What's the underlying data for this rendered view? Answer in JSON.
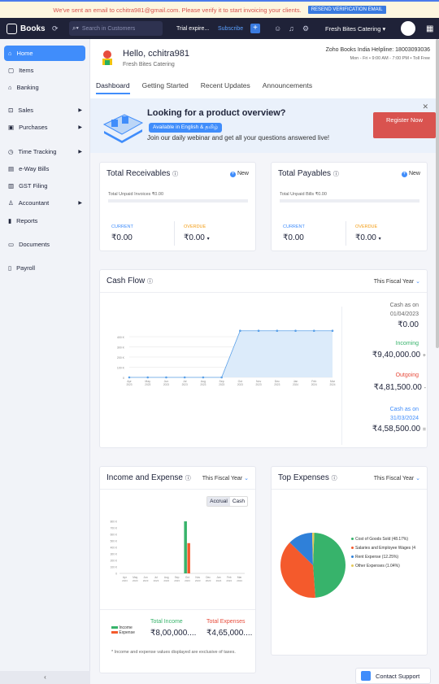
{
  "banner": {
    "message": "We've sent an email to cchitra981@gmail.com. Please verify it to start invoicing your clients.",
    "button": "RESEND VERIFICATION EMAIL"
  },
  "topbar": {
    "app_name": "Books",
    "search_placeholder": "Search in Customers",
    "trial": "Trial expire...",
    "subscribe": "Subscribe",
    "org": "Fresh Bites Catering"
  },
  "sidebar": {
    "items": [
      {
        "label": "Home"
      },
      {
        "label": "Items"
      },
      {
        "label": "Banking"
      },
      {
        "label": "Sales"
      },
      {
        "label": "Purchases"
      },
      {
        "label": "Time Tracking"
      },
      {
        "label": "e-Way Bills"
      },
      {
        "label": "GST Filing"
      },
      {
        "label": "Accountant"
      },
      {
        "label": "Reports"
      },
      {
        "label": "Documents"
      },
      {
        "label": "Payroll"
      }
    ]
  },
  "header": {
    "hello": "Hello, cchitra981",
    "company": "Fresh Bites Catering",
    "helpline": "Zoho Books India Helpline: 18003093036",
    "hours": "Mon - Fri • 9:00 AM - 7:00 PM • Toll Free"
  },
  "tabs": [
    "Dashboard",
    "Getting Started",
    "Recent Updates",
    "Announcements"
  ],
  "promo": {
    "title": "Looking for a product overview?",
    "lang": "Available in English & தமிழ்",
    "sub": "Join our daily webinar and get all your questions answered live!",
    "register": "Register Now"
  },
  "receivables": {
    "title": "Total Receivables",
    "new": "New",
    "unpaid": "Total Unpaid Invoices ₹0.00",
    "current_label": "CURRENT",
    "current_value": "₹0.00",
    "overdue_label": "OVERDUE",
    "overdue_value": "₹0.00"
  },
  "payables": {
    "title": "Total Payables",
    "new": "New",
    "unpaid": "Total Unpaid Bills ₹0.00",
    "current_label": "CURRENT",
    "current_value": "₹0.00",
    "overdue_label": "OVERDUE",
    "overdue_value": "₹0.00"
  },
  "cashflow": {
    "title": "Cash Flow",
    "period": "This Fiscal Year",
    "cash_as_on_label": "Cash as on",
    "start_date": "01/04/2023",
    "start_value": "₹0.00",
    "incoming_label": "Incoming",
    "incoming_value": "₹9,40,000.00",
    "outgoing_label": "Outgoing",
    "outgoing_value": "₹4,81,500.00",
    "end_label": "Cash as on",
    "end_date": "31/03/2024",
    "end_value": "₹4,58,500.00",
    "plus": "+",
    "minus": "-",
    "equals": "="
  },
  "income_expense": {
    "title": "Income and Expense",
    "period": "This Fiscal Year",
    "accrual": "Accrual",
    "cash": "Cash",
    "income_label": "Total Income",
    "income_value": "₹8,00,000....",
    "expense_label": "Total Expenses",
    "expense_value": "₹4,65,000....",
    "legend_income": "Income",
    "legend_expense": "Expense",
    "note": "* Income and expense values displayed are exclusive of taxes."
  },
  "top_expenses": {
    "title": "Top Expenses",
    "period": "This Fiscal Year"
  },
  "support": "Contact Support",
  "chart_data": [
    {
      "type": "area",
      "title": "Cash Flow",
      "categories": [
        "Apr 2023",
        "May 2023",
        "Jun 2023",
        "Jul 2023",
        "Aug 2023",
        "Sep 2023",
        "Oct 2023",
        "Nov 2023",
        "Dec 2023",
        "Jan 2024",
        "Feb 2024",
        "Mar 2024"
      ],
      "yticks": [
        "0",
        "100 K",
        "200 K",
        "300 K",
        "400 K"
      ],
      "values": [
        0,
        0,
        0,
        0,
        0,
        0,
        458500,
        458500,
        458500,
        458500,
        458500,
        458500
      ],
      "ylim": [
        0,
        600000
      ],
      "color": "#5aa0e8"
    },
    {
      "type": "bar",
      "title": "Income and Expense",
      "categories": [
        "Apr 2023",
        "May 2023",
        "Jun 2023",
        "Jul 2023",
        "Aug 2023",
        "Sep 2023",
        "Oct 2023",
        "Nov 2023",
        "Dec 2023",
        "Jan 2024",
        "Feb 2024",
        "Mar 2024"
      ],
      "yticks": [
        "0",
        "100 K",
        "200 K",
        "300 K",
        "400 K",
        "500 K",
        "600 K",
        "700 K",
        "800 K"
      ],
      "series": [
        {
          "name": "Income",
          "color": "#37b36b",
          "values": [
            0,
            0,
            0,
            0,
            0,
            0,
            800000,
            0,
            0,
            0,
            0,
            0
          ]
        },
        {
          "name": "Expense",
          "color": "#f45a2c",
          "values": [
            0,
            0,
            0,
            0,
            0,
            0,
            465000,
            0,
            0,
            0,
            0,
            0
          ]
        }
      ],
      "ylim": [
        0,
        800000
      ]
    },
    {
      "type": "pie",
      "title": "Top Expenses",
      "slices": [
        {
          "label": "Cost of Goods Sold (48.17%)",
          "value": 48.17,
          "color": "#37b36b"
        },
        {
          "label": "Salaries and Employee Wages (4",
          "value": 38.5,
          "color": "#f45a2c"
        },
        {
          "label": "Rent Expense (12.25%)",
          "value": 12.25,
          "color": "#2f80d9"
        },
        {
          "label": "Other Expenses (1.04%)",
          "value": 1.04,
          "color": "#e5c95a"
        }
      ]
    }
  ]
}
